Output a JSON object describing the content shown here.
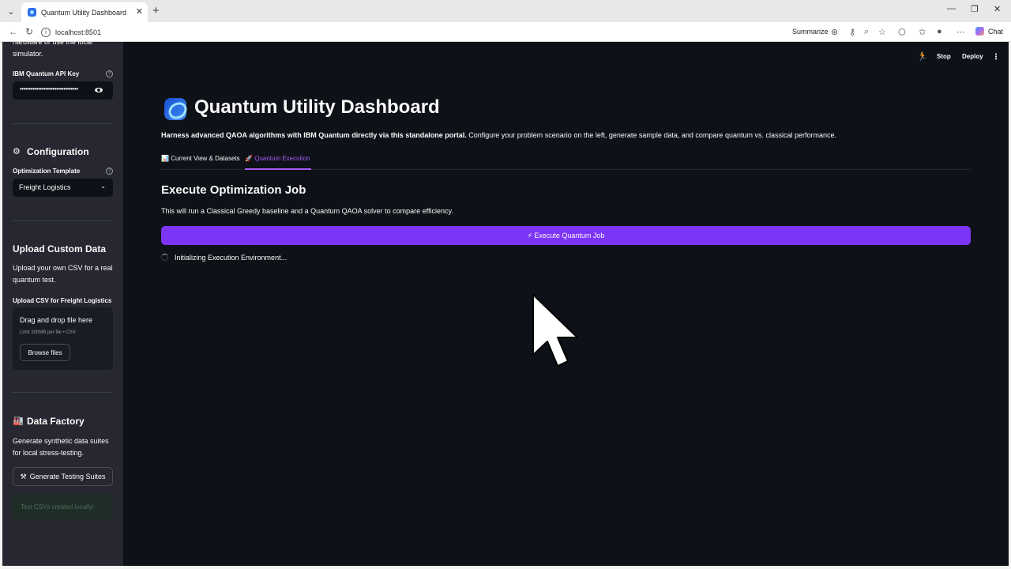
{
  "browser": {
    "tab_title": "Quantum Utility Dashboard",
    "url": "localhost:8501",
    "summarize_label": "Summarize",
    "chat_label": "Chat"
  },
  "sidebar": {
    "intro_partial_1": "hardware or use the local",
    "intro_partial_2": "simulator.",
    "api_key_label": "IBM Quantum API Key",
    "api_key_value": "••••••••••••••••••••••••••••••••",
    "configuration_heading": "Configuration",
    "template_label": "Optimization Template",
    "template_value": "Freight Logistics",
    "upload_heading": "Upload Custom Data",
    "upload_desc_1": "Upload your own CSV for a real",
    "upload_desc_2": "quantum test.",
    "upload_label": "Upload CSV for Freight Logistics",
    "dropzone_title": "Drag and drop file here",
    "dropzone_limit": "Limit 200MB per file • CSV",
    "browse_label": "Browse files",
    "factory_heading": "Data Factory",
    "factory_desc_1": "Generate synthetic data suites",
    "factory_desc_2": "for local stress-testing.",
    "generate_label": "Generate Testing Suites",
    "success_text": "Test CSVs created locally!"
  },
  "topbar": {
    "stop_label": "Stop",
    "deploy_label": "Deploy"
  },
  "main": {
    "title": "Quantum Utility Dashboard",
    "intro_bold": "Harness advanced QAOA algorithms with IBM Quantum directly via this standalone portal.",
    "intro_rest": " Configure your problem scenario on the left, generate sample data, and compare quantum vs. classical performance.",
    "tabs": [
      {
        "icon": "📊",
        "label": "Current View & Datasets"
      },
      {
        "icon": "🚀",
        "label": "Quantum Execution"
      }
    ],
    "section_heading": "Execute Optimization Job",
    "section_desc": "This will run a Classical Greedy baseline and a Quantum QAOA solver to compare efficiency.",
    "execute_label": "⚡ Execute Quantum Job",
    "status_text": "Initializing Execution Environment..."
  },
  "colors": {
    "app_bg": "#0e1117",
    "sidebar_bg": "#262730",
    "accent": "#7d35f5",
    "tab_active": "#a95af8"
  }
}
